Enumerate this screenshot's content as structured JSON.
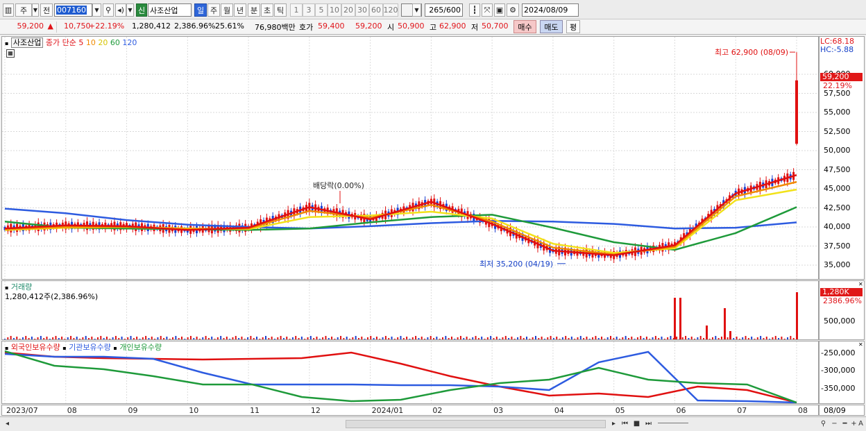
{
  "toolbar": {
    "type_label": "주",
    "all_label": "전",
    "code_value": "007160",
    "credit_badge": "신",
    "stock_name": "사조산업",
    "periods": [
      "일",
      "주",
      "월",
      "년",
      "분",
      "초",
      "틱"
    ],
    "selected_period": "일",
    "intervals": [
      "1",
      "3",
      "5",
      "10",
      "20",
      "30",
      "60",
      "120"
    ],
    "count_value": "265",
    "count_max": "/600",
    "date_value": "2024/08/09"
  },
  "quote": {
    "price": "59,200",
    "change_arrow": "▲",
    "change": "10,750",
    "change_pct": "+22.19%",
    "volume": "1,280,412",
    "volume_pct": "2,386.96%",
    "turnover": "25.61%",
    "amount": "76,980백만",
    "hoga_label": "호가",
    "ask": "59,400",
    "bid": "59,200",
    "open_label": "시",
    "open": "50,900",
    "high_label": "고",
    "high": "62,900",
    "low_label": "저",
    "low": "50,700",
    "buy_button": "매수",
    "sell_button": "매도",
    "eval_button": "평"
  },
  "price_panel": {
    "name_chip": "사조산업",
    "ma_title": "종가 단순",
    "ma_periods": [
      "5",
      "10",
      "20",
      "60",
      "120"
    ],
    "lc": "LC:68.18",
    "hc": "HC:-5.88",
    "current_price_tag": "59,200",
    "current_pct_tag": "22.19%",
    "high_annotation": "최고 62,900 (08/09)",
    "low_annotation": "최저 35,200 (04/19)",
    "dividend_annotation": "배당락(0.00%)",
    "y_ticks": [
      "60,000",
      "57,500",
      "55,000",
      "52,500",
      "50,000",
      "47,500",
      "45,000",
      "42,500",
      "40,000",
      "37,500",
      "35,000"
    ]
  },
  "volume_panel": {
    "title": "거래량",
    "summary": "1,280,412주(2,386.96%)",
    "tag_value": "1,280K",
    "tag_pct": "2386.96%",
    "y_ticks": [
      "500,000"
    ]
  },
  "holdings_panel": {
    "series_labels": [
      "외국인보유수량",
      "기관보유수량",
      "개인보유수량"
    ],
    "y_ticks": [
      "-250,000",
      "-300,000",
      "-350,000"
    ]
  },
  "x_axis": {
    "labels": [
      "2023/07",
      "08",
      "09",
      "10",
      "11",
      "12",
      "2024/01",
      "02",
      "03",
      "04",
      "05",
      "06",
      "07",
      "08"
    ],
    "end_label": "08/09"
  },
  "colors": {
    "ma5": "#e01010",
    "ma10": "#f08a00",
    "ma20": "#f2e21a",
    "ma60": "#1e9a3a",
    "ma120": "#2d5be0",
    "up": "#e01010",
    "down": "#1a3fd0"
  },
  "chart_data": {
    "type": "line",
    "x": [
      "2023/07",
      "08",
      "09",
      "10",
      "11",
      "12",
      "2024/01",
      "02",
      "03",
      "04",
      "05",
      "06",
      "07",
      "08"
    ],
    "ylim": [
      34000,
      64000
    ],
    "series": [
      {
        "name": "5",
        "values": [
          39800,
          40200,
          40100,
          39600,
          39900,
          42600,
          41000,
          43300,
          40400,
          36900,
          36300,
          37600,
          44400,
          46800
        ]
      },
      {
        "name": "10",
        "values": [
          39700,
          40000,
          40000,
          39700,
          39800,
          42100,
          41200,
          42900,
          40700,
          37300,
          36400,
          37400,
          44000,
          45900
        ]
      },
      {
        "name": "20",
        "values": [
          39600,
          39900,
          40000,
          39800,
          39700,
          41300,
          41500,
          42000,
          41100,
          37800,
          36600,
          37200,
          43500,
          44900
        ]
      },
      {
        "name": "60",
        "values": [
          40700,
          39900,
          39800,
          39700,
          39600,
          39800,
          40600,
          41300,
          41600,
          39900,
          38000,
          37000,
          39200,
          42600
        ]
      },
      {
        "name": "120",
        "values": [
          42400,
          41800,
          40900,
          40300,
          40000,
          39800,
          40100,
          40500,
          40800,
          40700,
          40400,
          39800,
          39900,
          40600
        ]
      }
    ],
    "annotations": {
      "high": {
        "date": "08/09",
        "value": 62900
      },
      "low": {
        "date": "04/19",
        "value": 35200
      },
      "last_close": 59200
    }
  }
}
